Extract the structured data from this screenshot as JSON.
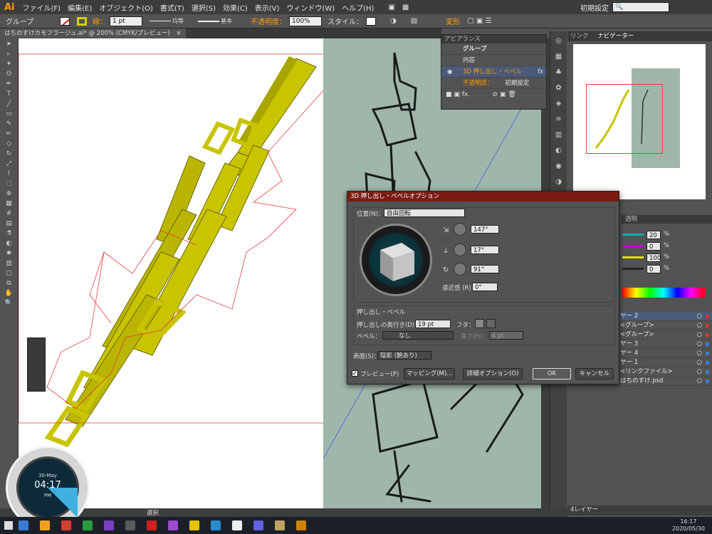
{
  "app": {
    "logo": "Ai",
    "workspace": "初期設定"
  },
  "menu": [
    "ファイル(F)",
    "編集(E)",
    "オブジェクト(O)",
    "書式(T)",
    "選択(S)",
    "効果(C)",
    "表示(V)",
    "ウィンドウ(W)",
    "ヘルプ(H)"
  ],
  "control": {
    "selection": "グループ",
    "stroke_label": "線：",
    "stroke_weight": "1 pt",
    "profile": "均等",
    "brush": "基本",
    "opacity_label": "不透明度：",
    "opacity": "100%",
    "style_label": "スタイル：",
    "transform": "変形"
  },
  "doc_tab": {
    "title": "はちのすけカモフラージュ.ai* @ 200% (CMYK/プレビュー)",
    "close": "×"
  },
  "appearance": {
    "title": "アピアランス",
    "items": [
      {
        "label": "グループ"
      },
      {
        "label": "内容"
      },
      {
        "label": "3D 押し出し・ベベル",
        "fx": "fx"
      },
      {
        "label": "不透明度：",
        "value": "初期設定"
      }
    ]
  },
  "navigator": {
    "tabs": [
      "リンク",
      "ナビゲーター"
    ]
  },
  "dialog": {
    "title": "3D 押し出し・ベベルオプション",
    "position_label": "位置(N)：",
    "position_value": "自由回転",
    "angle_x": "147°",
    "angle_y": "17°",
    "angle_z": "91°",
    "perspective_label": "遠近感 (R)：",
    "perspective_value": "0°",
    "section_extrude": "押し出し・ベベル",
    "depth_label": "押し出しの奥行き(D)：",
    "depth_value": "19 pt",
    "cap_label": "フタ：",
    "bevel_label": "ベベル：",
    "bevel_value": "なし",
    "height_label": "高さ(H)：",
    "height_value": "4 pt",
    "surface_label": "表面(S)：",
    "surface_value": "陰影 (艶あり)",
    "preview_label": "プレビュー(P)",
    "map_button": "マッピング(M)...",
    "more_button": "詳細オプション(O)",
    "ok_button": "OK",
    "cancel_button": "キャンセル"
  },
  "color": {
    "tab": "透明",
    "values": [
      "20",
      "0",
      "100",
      "0"
    ],
    "unit": "%"
  },
  "layers": {
    "items": [
      {
        "label": "ヤー 2",
        "color": "#e03030"
      },
      {
        "label": "<グループ>",
        "color": "#e03030"
      },
      {
        "label": "<グループ>",
        "color": "#e03030"
      },
      {
        "label": "ヤー 3",
        "color": "#3a7bd5"
      },
      {
        "label": "ヤー 4",
        "color": "#3a7bd5"
      },
      {
        "label": "ヤー 1",
        "color": "#3a7bd5"
      },
      {
        "label": "<リンクファイル>",
        "color": "#3a7bd5"
      },
      {
        "label": "はちのすけ.psd",
        "color": "#3a7bd5"
      }
    ],
    "count": "4レイヤー"
  },
  "status": {
    "mode": "選択"
  },
  "clock": {
    "date": "30-May",
    "time": "04:17",
    "ampm": "PM"
  },
  "taskbar": {
    "time": "16:17",
    "date": "2020/05/30"
  },
  "colors": {
    "accent": "#ff9a00",
    "object": "#c8c400",
    "dialog_title": "#7a1c14"
  }
}
